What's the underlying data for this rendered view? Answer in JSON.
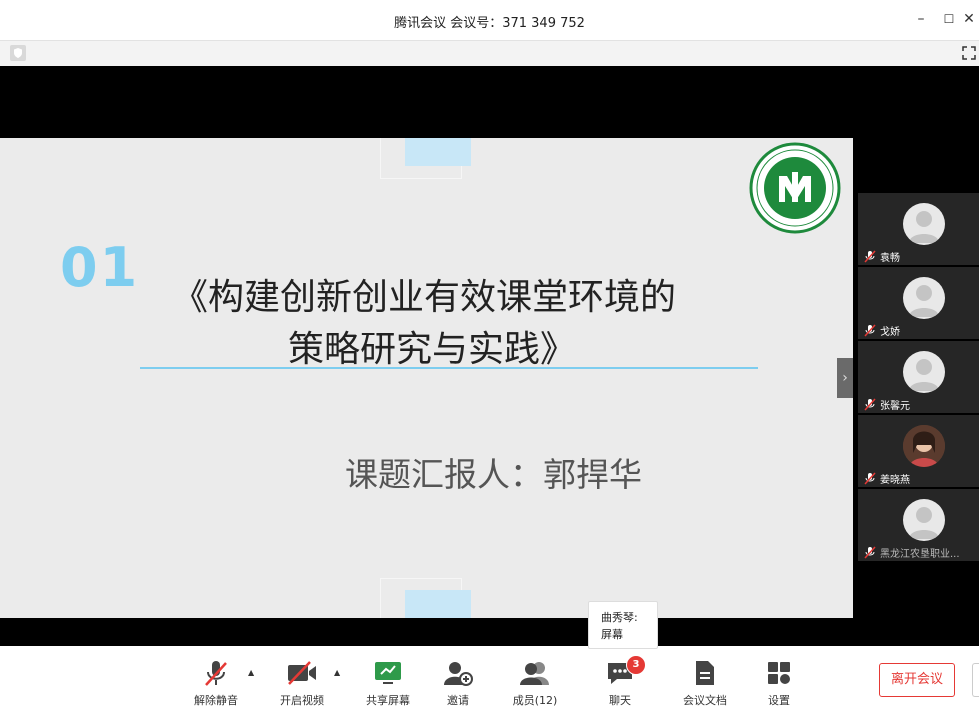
{
  "window": {
    "title": "腾讯会议 会议号：371 349 752",
    "minimize": "–",
    "maximize": "☐",
    "close": "✕"
  },
  "slide": {
    "number": "01",
    "title_line1": "《构建创新创业有效课堂环境的",
    "title_line2": "策略研究与实践》",
    "reporter": "课题汇报人：郭捍华",
    "logo_mark": "M"
  },
  "participants": [
    {
      "name": "袁畅",
      "muted": true,
      "avatar": "default"
    },
    {
      "name": "戈娇",
      "muted": true,
      "avatar": "default"
    },
    {
      "name": "张馨元",
      "muted": true,
      "avatar": "default"
    },
    {
      "name": "姜晓燕",
      "muted": true,
      "avatar": "photo"
    },
    {
      "name": "黑龙江农垦职业...",
      "muted": true,
      "avatar": "default"
    }
  ],
  "toolbar": {
    "unmute": "解除静音",
    "start_video": "开启视频",
    "share_screen": "共享屏幕",
    "invite": "邀请",
    "members": "成员(12)",
    "chat": "聊天",
    "docs": "会议文档",
    "settings": "设置",
    "leave": "离开会议",
    "chat_badge": "3"
  },
  "tooltip": {
    "line1": "曲秀琴:",
    "line2": "屏幕"
  },
  "colors": {
    "accent_blue": "#7dcdef",
    "leave_red": "#e53935",
    "logo_green": "#1e8a3c"
  }
}
